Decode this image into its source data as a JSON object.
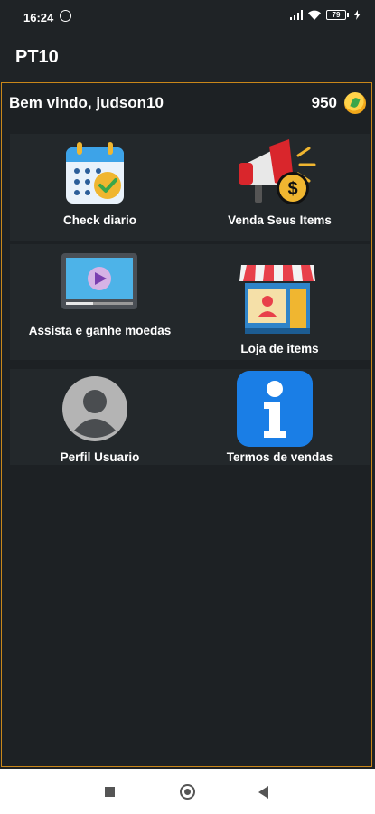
{
  "status_bar": {
    "time": "16:24",
    "battery": "79"
  },
  "app_bar": {
    "title": "PT10"
  },
  "header": {
    "welcome": "Bem vindo, judson10",
    "coins": "950"
  },
  "menu": {
    "check_diario": "Check diario",
    "venda_items": "Venda Seus Items",
    "assista": "Assista e ganhe moedas",
    "loja": "Loja de items",
    "perfil": "Perfil Usuario",
    "termos": "Termos de vendas"
  },
  "colors": {
    "background": "#1f2326",
    "border": "#c9871a",
    "info_blue": "#1a7ee6"
  },
  "icons": [
    "whatsapp-icon",
    "signal-icon",
    "wifi-icon",
    "battery-icon",
    "coin-icon",
    "calendar-check-icon",
    "megaphone-dollar-icon",
    "video-player-icon",
    "store-icon",
    "user-avatar-icon",
    "info-icon"
  ]
}
